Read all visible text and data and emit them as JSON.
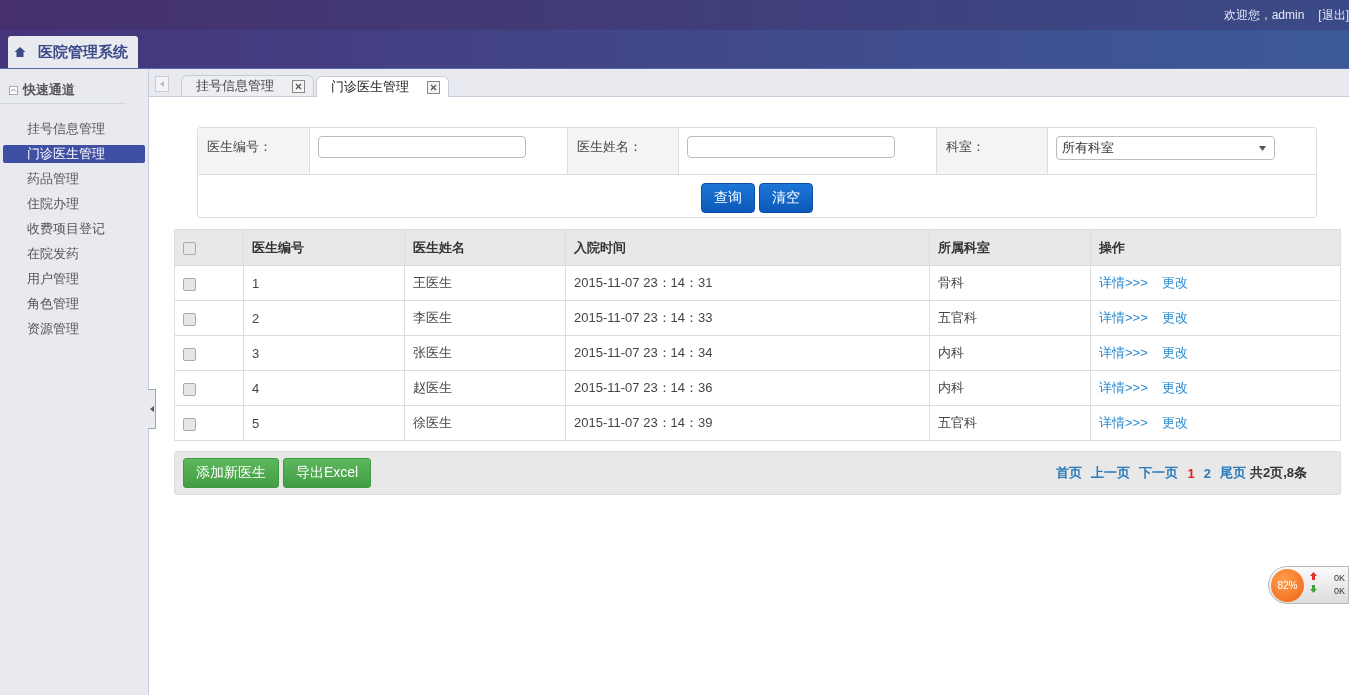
{
  "header": {
    "greeting": "欢迎您，admin",
    "logout": "[退出]",
    "brand": "医院管理系统"
  },
  "sidebar": {
    "title": "快速通道",
    "items": [
      {
        "label": "挂号信息管理",
        "selected": false
      },
      {
        "label": "门诊医生管理",
        "selected": true
      },
      {
        "label": "药品管理",
        "selected": false
      },
      {
        "label": "住院办理",
        "selected": false
      },
      {
        "label": "收费项目登记",
        "selected": false
      },
      {
        "label": "在院发药",
        "selected": false
      },
      {
        "label": "用户管理",
        "selected": false
      },
      {
        "label": "角色管理",
        "selected": false
      },
      {
        "label": "资源管理",
        "selected": false
      }
    ]
  },
  "tabs": [
    {
      "label": "挂号信息管理",
      "selected": false
    },
    {
      "label": "门诊医生管理",
      "selected": true
    }
  ],
  "search": {
    "fields": [
      {
        "label": "医生编号：",
        "kind": "text"
      },
      {
        "label": "医生姓名：",
        "kind": "text"
      },
      {
        "label": "科室：",
        "kind": "select",
        "value": "所有科室"
      }
    ],
    "buttons": [
      "查询",
      "清空"
    ]
  },
  "table": {
    "select_all_checked": false,
    "columns": [
      "医生编号",
      "医生姓名",
      "入院时间",
      "所属科室",
      "操作"
    ],
    "rows": [
      {
        "checked": false,
        "cells": [
          "1",
          "王医生",
          "2015-11-07 23：14：31",
          "骨科"
        ],
        "actions": [
          "详情>>>",
          "更改"
        ]
      },
      {
        "checked": false,
        "cells": [
          "2",
          "李医生",
          "2015-11-07 23：14：33",
          "五官科"
        ],
        "actions": [
          "详情>>>",
          "更改"
        ]
      },
      {
        "checked": false,
        "cells": [
          "3",
          "张医生",
          "2015-11-07 23：14：34",
          "内科"
        ],
        "actions": [
          "详情>>>",
          "更改"
        ]
      },
      {
        "checked": false,
        "cells": [
          "4",
          "赵医生",
          "2015-11-07 23：14：36",
          "内科"
        ],
        "actions": [
          "详情>>>",
          "更改"
        ]
      },
      {
        "checked": false,
        "cells": [
          "5",
          "徐医生",
          "2015-11-07 23：14：39",
          "五官科"
        ],
        "actions": [
          "详情>>>",
          "更改"
        ]
      }
    ]
  },
  "footer": {
    "buttons": [
      "添加新医生",
      "导出Excel"
    ],
    "first": "首页",
    "prev": "上一页",
    "next": "下一页",
    "pages": [
      {
        "label": "1",
        "selected": true
      },
      {
        "label": "2",
        "selected": false
      }
    ],
    "last": "尾页",
    "summary": "共2页,8条"
  },
  "widget": {
    "percent": "82%",
    "up": "0K",
    "down": "0K"
  }
}
